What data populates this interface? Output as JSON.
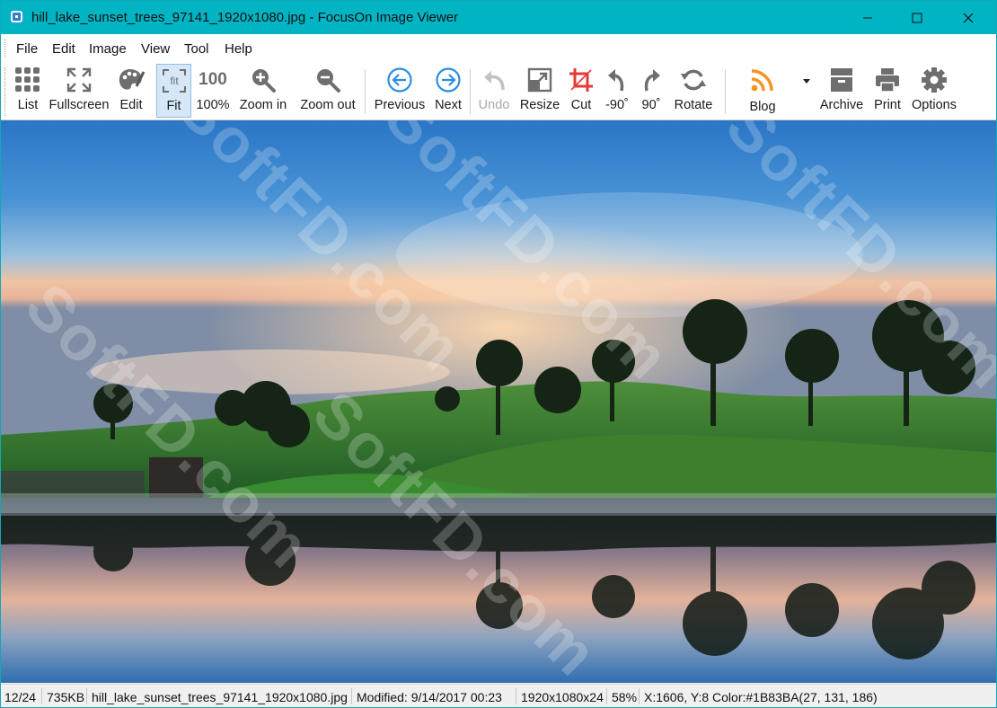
{
  "window": {
    "title": "hill_lake_sunset_trees_97141_1920x1080.jpg - FocusOn Image Viewer"
  },
  "menu": [
    "File",
    "Edit",
    "Image",
    "View",
    "Tool",
    "Help"
  ],
  "toolbar": {
    "list": "List",
    "fullscreen": "Fullscreen",
    "edit": "Edit",
    "fit": "Fit",
    "fit_icon_text": "fit",
    "actual": "100%",
    "actual_icon_text": "100",
    "zoom_in": "Zoom in",
    "zoom_out": "Zoom out",
    "previous": "Previous",
    "next": "Next",
    "undo": "Undo",
    "resize": "Resize",
    "cut": "Cut",
    "rot_left": "-90˚",
    "rot_right": "90˚",
    "rotate": "Rotate",
    "blog": "Blog",
    "archive": "Archive",
    "print": "Print",
    "options": "Options"
  },
  "icons": {
    "list": "grid-icon",
    "fullscreen": "fullscreen-arrows-icon",
    "edit": "palette-icon",
    "fit": "fit-frame-icon",
    "zoom_in": "magnifier-plus-icon",
    "zoom_out": "magnifier-minus-icon",
    "previous": "circle-arrow-left-icon",
    "next": "circle-arrow-right-icon",
    "undo": "undo-arrow-icon",
    "resize": "resize-icon",
    "cut": "crop-icon",
    "rotate": "rotate-icon",
    "blog": "rss-icon",
    "archive": "archive-box-icon",
    "print": "printer-icon",
    "options": "gear-icon"
  },
  "colors": {
    "titlebar": "#00b4c4",
    "accent_blue": "#2b8fe0",
    "crop_red": "#e53935",
    "rss_orange": "#f7931e",
    "icon_gray": "#6e6e6e"
  },
  "watermark": "SoftFD.com",
  "status": {
    "index": "12/24",
    "size": "735KB",
    "filename": "hill_lake_sunset_trees_97141_1920x1080.jpg",
    "modified": "Modified: 9/14/2017 00:23",
    "dimensions": "1920x1080x24",
    "zoom": "58%",
    "pixel_info": "X:1606, Y:8 Color:#1B83BA(27, 131, 186)"
  }
}
